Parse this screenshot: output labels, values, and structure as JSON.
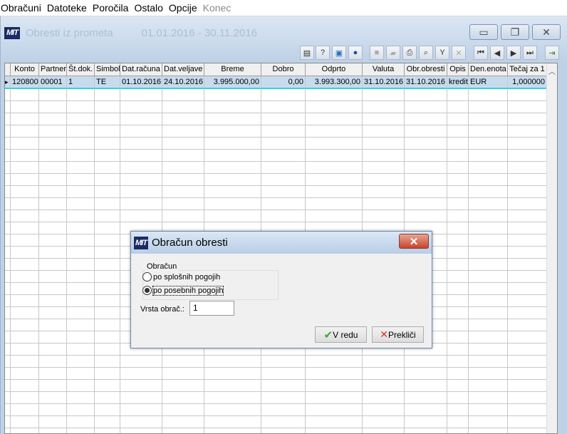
{
  "menu": [
    "Obračuni",
    "Datoteke",
    "Poročila",
    "Ostalo",
    "Opcije",
    "Konec"
  ],
  "window": {
    "logo": "MIT",
    "title": "Obresti iz prometa",
    "dates": "01.01.2016 - 30.11.2016"
  },
  "toolbar": [
    "report-icon",
    "help-book-icon",
    "monitor-icon",
    "help-icon",
    "new-icon",
    "open-icon",
    "print-icon",
    "search-icon",
    "filter-icon",
    "clear-filter-icon",
    "first-icon",
    "prev-icon",
    "next-icon",
    "last-icon",
    "exit-icon"
  ],
  "grid": {
    "columns": [
      "Konto",
      "Partner",
      "Št.dok.",
      "Simbol",
      "Dat.računa",
      "Dat.veljave",
      "Breme",
      "Dobro",
      "Odprto",
      "Valuta",
      "Obr.obresti",
      "Opis",
      "Den.enota",
      "Tečaj za 1"
    ],
    "rows": [
      [
        "120800",
        "00001",
        "1",
        "TE",
        "01.10.2016",
        "24.10.2016",
        "3.995.000,00",
        "0,00",
        "3.993.300,00",
        "31.10.2016",
        "31.10.2016",
        "kredit",
        "EUR",
        "1,000000"
      ]
    ]
  },
  "dialog": {
    "logo": "MIT",
    "title": "Obračun obresti",
    "group": "Obračun",
    "option1": "po splošnih pogojih",
    "option2": "po posebnih pogojih",
    "selected": "po posebnih pogojih",
    "vrsta_label": "Vrsta obrač.:",
    "vrsta_value": "1",
    "ok": "V redu",
    "cancel": "Prekliči"
  }
}
